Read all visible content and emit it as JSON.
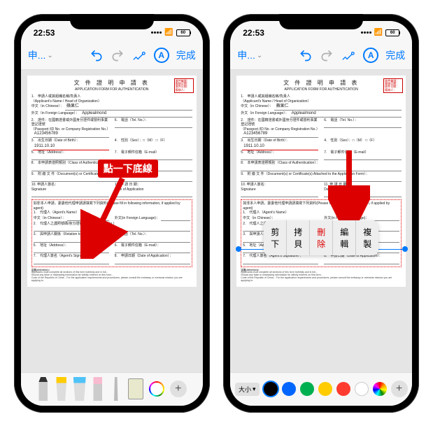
{
  "status": {
    "time": "22:53",
    "battery": "60"
  },
  "toolbar": {
    "back": "申...",
    "done": "完成"
  },
  "doc": {
    "title": "文 件 證 明 申 請 表",
    "subtitle": "APPLICATION FORM FOR AUTHENTICATION",
    "stamp_line1": "收件編號：",
    "stamp_line2": "簽辦日期：",
    "stamp_line3": "收件日期：",
    "stamp_line4": "簽辦人：",
    "field1_lbl": "1.　申請人或其組織名稱/負責人",
    "field1_sub": "（Applicant's Name / Head of Organization）",
    "field1a_lbl": "中文（in Chinese）：",
    "field1a_val": "蘋果仁",
    "field1b_lbl": "外文（in Foreign Language）：",
    "field1b_val": "Applealmond",
    "field2_lbl": "2.　證件：在國籍證書或外國身分證件或營利事業登記證號",
    "field2_sub": "（Passport /ID No.  or Company Registration No.）",
    "field2_val": "A123456789",
    "field3_lbl": "3.　出生日期（Date of Birth）：",
    "field3_val": "1911.10.10",
    "field4_lbl": "4.　性別（Sex）：",
    "field4_m": "□（M）",
    "field4_f": "□（F）",
    "field5_lbl": "5.　地址（Address）：",
    "field6_lbl": "6.　電話（Tel. No.）：",
    "field7_lbl": "7.　電子郵件信箱（E-mail）",
    "field8_lbl": "8.　本申請表證照類別（Class of Authentication）：",
    "field9_lbl": "9.　附 繳 文 件（Document(s) or Certificate(s) Attached to the Application Form）：",
    "field10_lbl": "10. 申請人簽名：",
    "field10_sub": "Signature",
    "field11_lbl": "11. 申 請 日 期：",
    "field11_sub": "Date of Application",
    "redbox_head": "如非本人申請，委委他代理申請請填寫下列資料(Please fill in following information, if applied by agent)",
    "ra_lbl": "1.　代理人（Agent's Name）",
    "ra_cn": "中文（in Chinese）：",
    "ra_fl": "外文(in Foreign Language)：",
    "rb_lbl": "2.　代理人之護照號碼/身分證號碼(Passport /ID No.)",
    "rc_lbl": "3.　與申請人關係（Relation to Applicant）：",
    "rc2_lbl": "4.　電話（Tel. No.）：",
    "rd_lbl": "5.　地址（Address）：",
    "rd2_lbl": "6.　電子郵件信箱（E-mail）：",
    "re_lbl": "7.　代理人簽名（Agent's Signature）：",
    "re2_lbl": "8.　申請日期（Date of Application）：",
    "foot_head": "注意(Attention)：",
    "foot1": "Applicants must complete all sections of this form truthfully and in full...",
    "foot2": "Should any false or misleading information be wilfully entered on this form...",
    "foot3": "Code of the Republic of China... For the application requirements and procedures, please consult the embassy or overseas mission you are applying to."
  },
  "callout": {
    "text": "點一下底線"
  },
  "context_menu": {
    "cut": "剪下",
    "copy": "拷貝",
    "delete": "刪除",
    "edit": "編輯",
    "duplicate": "複製"
  },
  "size_label": "大小",
  "colors": {
    "black": "#000000",
    "blue": "#0066ff",
    "green": "#00b050",
    "yellow": "#ffcc00",
    "red": "#ff3b30",
    "white": "#ffffff"
  }
}
